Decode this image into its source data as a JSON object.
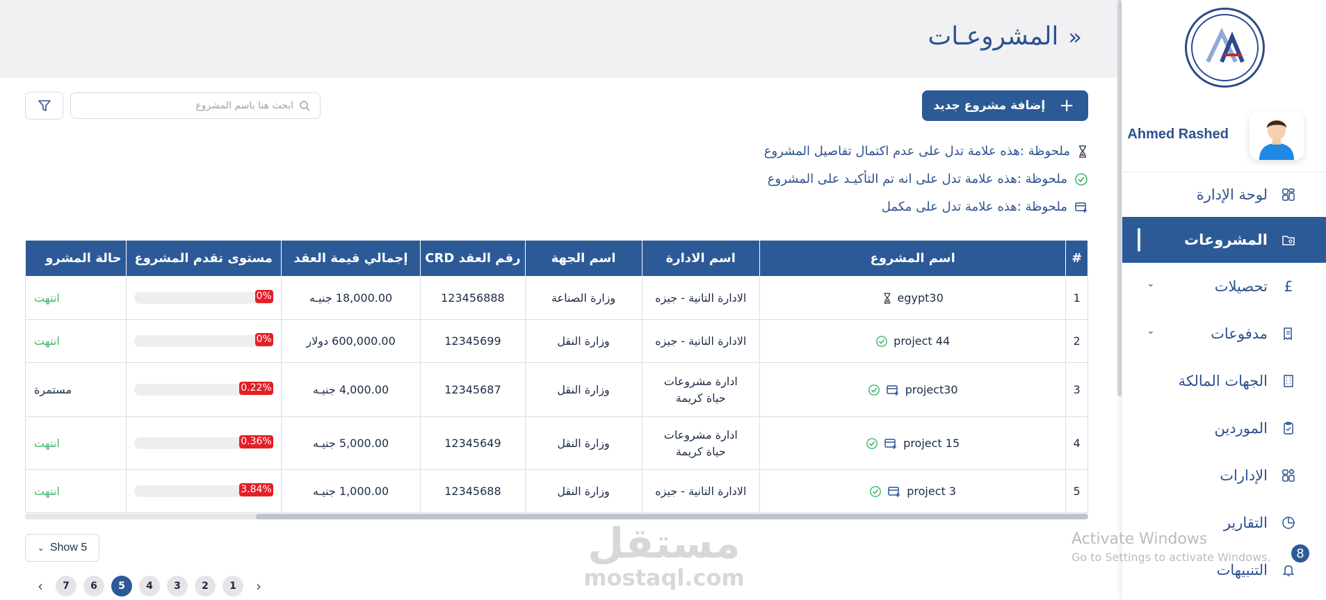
{
  "header": {
    "title": "المشروعـات"
  },
  "user": {
    "name": "Ahmed Rashed"
  },
  "sidebar": {
    "items": [
      {
        "label": "لوحة الإدارة",
        "icon": "dashboard-icon"
      },
      {
        "label": "المشروعات",
        "icon": "folder-icon",
        "active": true
      },
      {
        "label": "تحصيلات",
        "icon": "pound-icon",
        "expandable": true
      },
      {
        "label": "مدفوعات",
        "icon": "receipt-icon",
        "expandable": true
      },
      {
        "label": "الجهات المالكة",
        "icon": "building-icon"
      },
      {
        "label": "الموردين",
        "icon": "clipboard-icon"
      },
      {
        "label": "الإدارات",
        "icon": "departments-icon"
      },
      {
        "label": "التقارير",
        "icon": "pie-chart-icon"
      },
      {
        "label": "التنبيهات",
        "icon": "bell-icon"
      }
    ],
    "notification_count": "8"
  },
  "toolbar": {
    "add_label": "إضافة مشروع جديد",
    "search_placeholder": "ابحث هنا باسم المشروع"
  },
  "notes": [
    "ملحوظة :هذه علامة تدل على عدم اكتمال تفاصيل المشروع",
    "ملحوظة :هذه علامة تدل على انه تم التأكيـد على المشروع",
    "ملحوظة :هذه علامة تدل على مكمل"
  ],
  "table": {
    "headers": [
      "#",
      "اسم المشروع",
      "اسم الادارة",
      "اسم الجهة",
      "رقم العقد CRD",
      "إجمالي قيمة العقد",
      "مستوى تقدم المشروع",
      "حالة المشرو"
    ],
    "rows": [
      {
        "num": "1",
        "name": "egypt30",
        "icons": [
          "hourglass"
        ],
        "dept": "الادارة التانية - جيزه",
        "entity": "وزارة الصناعة",
        "contract": "123456888",
        "total": "18,000.00 جنيـه",
        "progress": "0%",
        "status": "انتهت",
        "done": true
      },
      {
        "num": "2",
        "name": "project 44",
        "icons": [
          "check"
        ],
        "dept": "الادارة التانية - جيزه",
        "entity": "وزارة النقل",
        "contract": "12345699",
        "total": "600,000.00 دولار",
        "progress": "0%",
        "status": "انتهت",
        "done": true
      },
      {
        "num": "3",
        "name": "project30",
        "icons": [
          "check",
          "card"
        ],
        "dept": "ادارة مشروعات حياة كريمة",
        "entity": "وزارة النقل",
        "contract": "12345687",
        "total": "4,000.00 جنيـه",
        "progress": "0.22%",
        "status": "مستمرة",
        "done": false
      },
      {
        "num": "4",
        "name": "project 15",
        "icons": [
          "check",
          "card"
        ],
        "dept": "ادارة مشروعات حياة كريمة",
        "entity": "وزارة النقل",
        "contract": "12345649",
        "total": "5,000.00 جنيـه",
        "progress": "0.36%",
        "status": "انتهت",
        "done": true
      },
      {
        "num": "5",
        "name": "project 3",
        "icons": [
          "check",
          "card"
        ],
        "dept": "الادارة التانية - جيزه",
        "entity": "وزارة النقل",
        "contract": "12345688",
        "total": "1,000.00 جنيـه",
        "progress": "3.84%",
        "status": "انتهت",
        "done": true
      }
    ]
  },
  "pagination": {
    "show_label": "Show 5",
    "pages": [
      "7",
      "6",
      "5",
      "4",
      "3",
      "2",
      "1"
    ],
    "active": "5"
  },
  "watermark": {
    "ar": "مستقل",
    "en": "mostaql.com"
  },
  "activation": {
    "title": "Activate Windows",
    "subtitle": "Go to Settings to activate Windows."
  },
  "colors": {
    "primary": "#2c5a96",
    "done": "#3db86a",
    "progress_badge": "#e41f26"
  }
}
